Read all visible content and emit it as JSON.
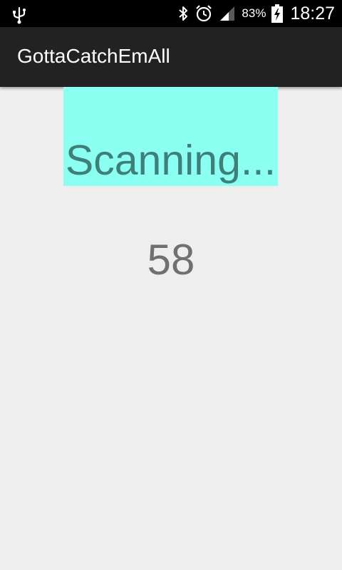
{
  "status_bar": {
    "icons": [
      "usb-icon",
      "bluetooth-icon",
      "alarm-icon",
      "signal-icon",
      "battery-charging-icon"
    ],
    "battery_percent": "83%",
    "time": "18:27"
  },
  "action_bar": {
    "title": "GottaCatchEmAll"
  },
  "main": {
    "status_text": "Scanning...",
    "count": "58"
  },
  "colors": {
    "status_bar_bg": "#000000",
    "action_bar_bg": "#222222",
    "content_bg": "#eeeeee",
    "scan_box_bg": "#8cfff3",
    "scan_text": "#3e8079",
    "count_text": "#707070"
  }
}
